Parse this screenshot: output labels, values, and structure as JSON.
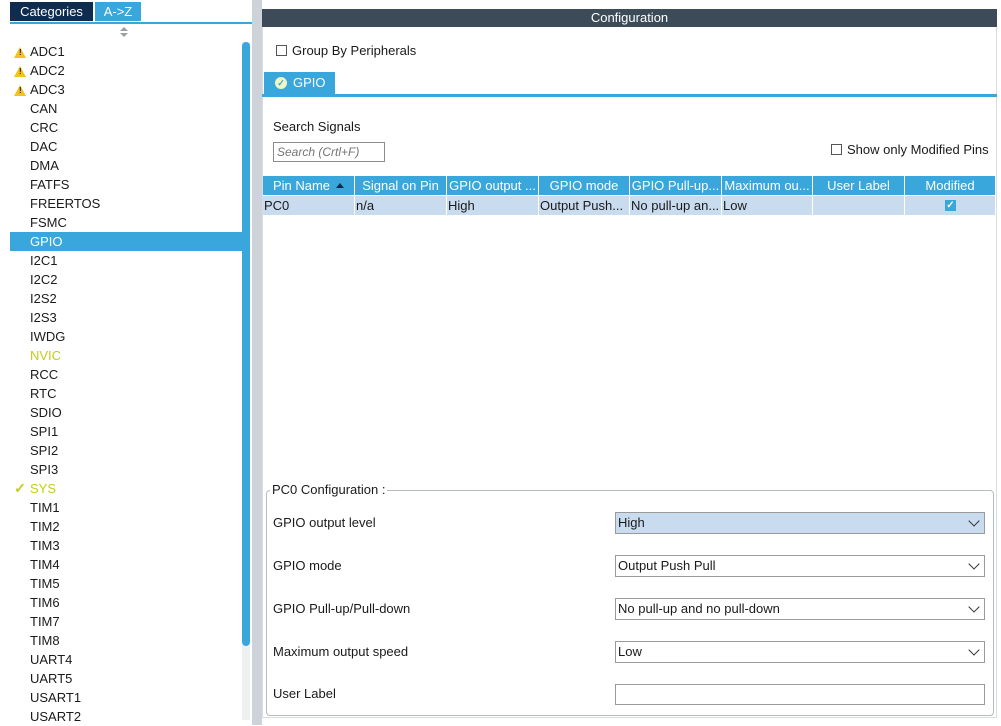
{
  "left_tabs": {
    "categories": "Categories",
    "az": "A->Z"
  },
  "peripherals": [
    {
      "label": "ADC1",
      "state": "warning"
    },
    {
      "label": "ADC2",
      "state": "warning"
    },
    {
      "label": "ADC3",
      "state": "warning"
    },
    {
      "label": "CAN",
      "state": ""
    },
    {
      "label": "CRC",
      "state": ""
    },
    {
      "label": "DAC",
      "state": ""
    },
    {
      "label": "DMA",
      "state": ""
    },
    {
      "label": "FATFS",
      "state": ""
    },
    {
      "label": "FREERTOS",
      "state": ""
    },
    {
      "label": "FSMC",
      "state": ""
    },
    {
      "label": "GPIO",
      "state": "selected"
    },
    {
      "label": "I2C1",
      "state": ""
    },
    {
      "label": "I2C2",
      "state": ""
    },
    {
      "label": "I2S2",
      "state": ""
    },
    {
      "label": "I2S3",
      "state": ""
    },
    {
      "label": "IWDG",
      "state": ""
    },
    {
      "label": "NVIC",
      "state": "configured"
    },
    {
      "label": "RCC",
      "state": ""
    },
    {
      "label": "RTC",
      "state": ""
    },
    {
      "label": "SDIO",
      "state": ""
    },
    {
      "label": "SPI1",
      "state": ""
    },
    {
      "label": "SPI2",
      "state": ""
    },
    {
      "label": "SPI3",
      "state": ""
    },
    {
      "label": "SYS",
      "state": "ok"
    },
    {
      "label": "TIM1",
      "state": ""
    },
    {
      "label": "TIM2",
      "state": ""
    },
    {
      "label": "TIM3",
      "state": ""
    },
    {
      "label": "TIM4",
      "state": ""
    },
    {
      "label": "TIM5",
      "state": ""
    },
    {
      "label": "TIM6",
      "state": ""
    },
    {
      "label": "TIM7",
      "state": ""
    },
    {
      "label": "TIM8",
      "state": ""
    },
    {
      "label": "UART4",
      "state": ""
    },
    {
      "label": "UART5",
      "state": ""
    },
    {
      "label": "USART1",
      "state": ""
    },
    {
      "label": "USART2",
      "state": ""
    }
  ],
  "config": {
    "title": "Configuration",
    "group_by_label": "Group By Peripherals",
    "group_by_checked": false,
    "tab_label": "GPIO",
    "search_label": "Search Signals",
    "search_placeholder": "Search (Crtl+F)",
    "show_modified_label": "Show only Modified Pins",
    "show_modified_checked": false,
    "columns": [
      "Pin Name",
      "Signal on Pin",
      "GPIO output ...",
      "GPIO mode",
      "GPIO Pull-up...",
      "Maximum ou...",
      "User Label",
      "Modified"
    ],
    "rows": [
      {
        "pin": "PC0",
        "signal": "n/a",
        "output": "High",
        "mode": "Output Push...",
        "pull": "No pull-up an...",
        "speed": "Low",
        "user_label": "",
        "modified": true
      }
    ],
    "pin_config": {
      "title": "PC0 Configuration :",
      "output_level_label": "GPIO output level",
      "output_level_value": "High",
      "mode_label": "GPIO mode",
      "mode_value": "Output Push Pull",
      "pull_label": "GPIO Pull-up/Pull-down",
      "pull_value": "No pull-up and no pull-down",
      "speed_label": "Maximum output speed",
      "speed_value": "Low",
      "user_label_label": "User Label",
      "user_label_value": ""
    }
  },
  "colors": {
    "accent": "#39a7dc",
    "dark_tab": "#0f2c4e",
    "header": "#3d4b59",
    "configured": "#c3cc1a",
    "warning": "#f3c21b",
    "row_selected": "#c9dbee"
  }
}
